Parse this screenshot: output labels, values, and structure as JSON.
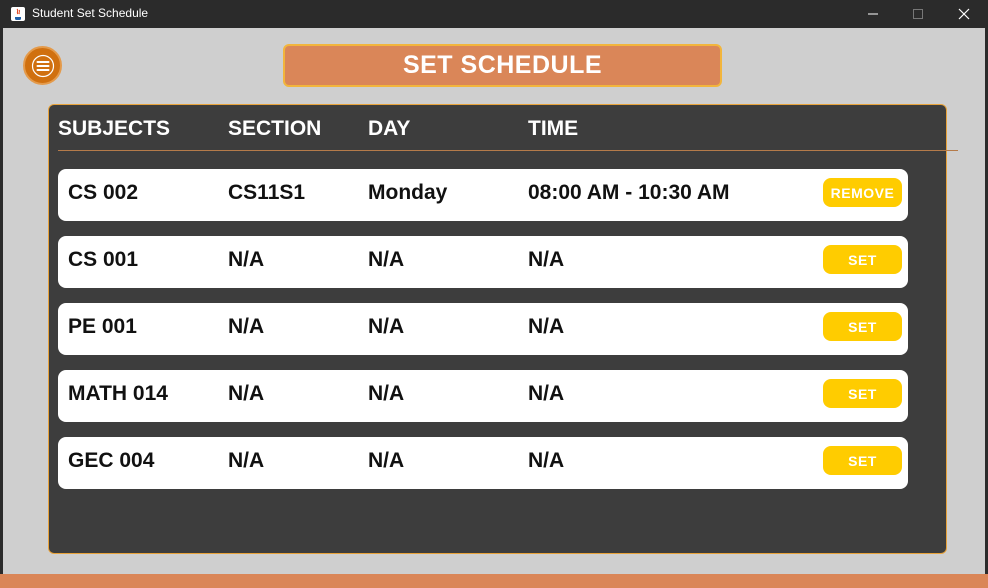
{
  "window": {
    "title": "Student Set Schedule",
    "controls": {
      "minimize": "─",
      "maximize": "☐",
      "close": "✕"
    }
  },
  "menu": {
    "icon": "hamburger-menu-icon"
  },
  "header": {
    "title": "SET SCHEDULE"
  },
  "table": {
    "columns": [
      "SUBJECTS",
      "SECTION",
      "DAY",
      "TIME"
    ],
    "rows": [
      {
        "subject": "CS 002",
        "section": "CS11S1",
        "day": "Monday",
        "time": "08:00 AM - 10:30 AM",
        "action": "REMOVE"
      },
      {
        "subject": "CS 001",
        "section": "N/A",
        "day": "N/A",
        "time": "N/A",
        "action": "SET"
      },
      {
        "subject": "PE 001",
        "section": "N/A",
        "day": "N/A",
        "time": "N/A",
        "action": "SET"
      },
      {
        "subject": "MATH 014",
        "section": "N/A",
        "day": "N/A",
        "time": "N/A",
        "action": "SET"
      },
      {
        "subject": "GEC 004",
        "section": "N/A",
        "day": "N/A",
        "time": "N/A",
        "action": "SET"
      }
    ]
  },
  "colors": {
    "accent_orange": "#da8658",
    "button_yellow": "#ffcc00",
    "panel_dark": "#3d3d3d",
    "titlebar": "#2b2b2b"
  }
}
